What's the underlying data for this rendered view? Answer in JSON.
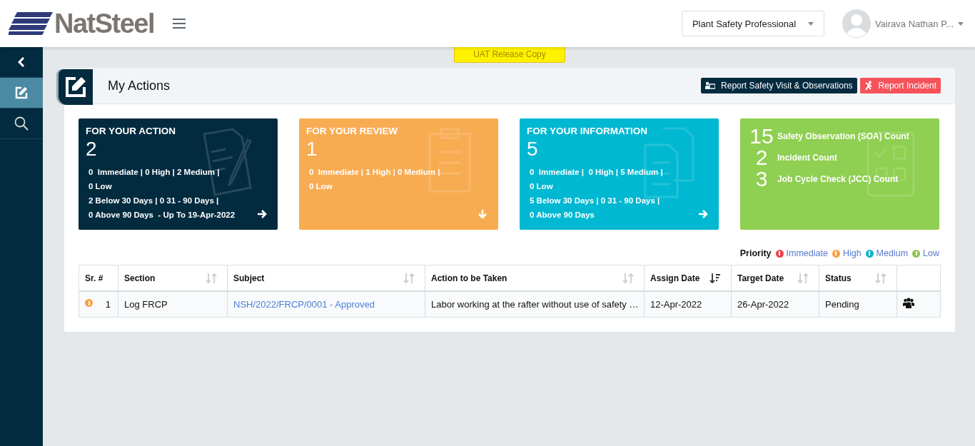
{
  "header": {
    "logo": "NatSteel",
    "role_select": "Plant Safety Professional",
    "user_name": "Vairava Nathan P..."
  },
  "sidebar": {
    "items": [
      {
        "kind": "collapse",
        "selected": false
      },
      {
        "kind": "edit",
        "selected": true
      },
      {
        "kind": "search",
        "selected": false
      }
    ]
  },
  "banner": "UAT Release Copy",
  "panel": {
    "title": "My Actions",
    "buttons": [
      {
        "kind": "visit",
        "label": "Report Safety Visit & Observations"
      },
      {
        "kind": "incident",
        "label": "Report Incident"
      }
    ],
    "cards": [
      {
        "kind": "summary",
        "title": "FOR YOUR ACTION",
        "count": "2",
        "color": "#032b3f",
        "lines": [
          "0  Immediate | 0 High | 2 Medium |",
          "0 Low",
          "2 Below 30 Days | 0 31 - 90 Days |",
          "0 Above 90 Days  - Up To 19-Apr-2022"
        ],
        "arrow_down": false
      },
      {
        "kind": "summary",
        "title": "FOR YOUR REVIEW",
        "count": "1",
        "color": "#f8ac52",
        "lines": [
          "0  Immediate | 1 High | 0 Medium |",
          "0 Low"
        ],
        "arrow_down": true
      },
      {
        "kind": "summary",
        "title": "FOR YOUR INFORMATION",
        "count": "5",
        "color": "#00b8d1",
        "lines": [
          "0  Immediate |  0 High | 5 Medium |",
          "0 Low",
          "5 Below 30 Days | 0 31 - 90 Days |",
          "0 Above 90 Days"
        ],
        "arrow_down": false
      },
      {
        "kind": "counts",
        "color": "#8fcf51",
        "items": [
          {
            "count": "15",
            "label": "Safety Observation (SOA) Count"
          },
          {
            "count": "2",
            "label": "Incident Count"
          },
          {
            "count": "3",
            "label": "Job Cycle Check (JCC) Count"
          }
        ]
      }
    ],
    "legend": {
      "label": "Priority",
      "items": [
        {
          "label": "Immediate",
          "color": "#f0434d"
        },
        {
          "label": "High",
          "color": "#f8a14a"
        },
        {
          "label": "Medium",
          "color": "#11b3cc"
        },
        {
          "label": "Low",
          "color": "#8cc653"
        }
      ]
    },
    "table": {
      "columns": [
        {
          "label": "Sr. #",
          "sortable": false,
          "sorted": false
        },
        {
          "label": "Section",
          "sortable": true,
          "sorted": false
        },
        {
          "label": "Subject",
          "sortable": true,
          "sorted": false
        },
        {
          "label": "Action to be Taken",
          "sortable": true,
          "sorted": false
        },
        {
          "label": "Assign Date",
          "sortable": true,
          "sorted": true
        },
        {
          "label": "Target Date",
          "sortable": true,
          "sorted": false
        },
        {
          "label": "Status",
          "sortable": true,
          "sorted": false
        },
        {
          "sortable": false,
          "sorted": false
        }
      ],
      "rows": [
        {
          "color": "#f8a14a",
          "sr": "1",
          "section": "Log FRCP",
          "subject": "NSH/2022/FRCP/0001 - Approved",
          "action": "Labor working at the rafter without use of safety …",
          "assign_date": "12-Apr-2022",
          "target_date": "26-Apr-2022",
          "status": "Pending"
        }
      ]
    }
  }
}
